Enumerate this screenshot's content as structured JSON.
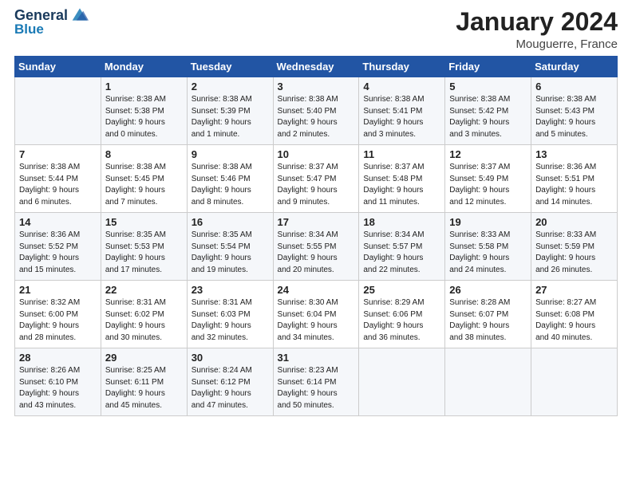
{
  "header": {
    "logo_line1": "General",
    "logo_line2": "Blue",
    "month": "January 2024",
    "location": "Mouguerre, France"
  },
  "weekdays": [
    "Sunday",
    "Monday",
    "Tuesday",
    "Wednesday",
    "Thursday",
    "Friday",
    "Saturday"
  ],
  "weeks": [
    [
      {
        "day": "",
        "info": ""
      },
      {
        "day": "1",
        "info": "Sunrise: 8:38 AM\nSunset: 5:38 PM\nDaylight: 9 hours\nand 0 minutes."
      },
      {
        "day": "2",
        "info": "Sunrise: 8:38 AM\nSunset: 5:39 PM\nDaylight: 9 hours\nand 1 minute."
      },
      {
        "day": "3",
        "info": "Sunrise: 8:38 AM\nSunset: 5:40 PM\nDaylight: 9 hours\nand 2 minutes."
      },
      {
        "day": "4",
        "info": "Sunrise: 8:38 AM\nSunset: 5:41 PM\nDaylight: 9 hours\nand 3 minutes."
      },
      {
        "day": "5",
        "info": "Sunrise: 8:38 AM\nSunset: 5:42 PM\nDaylight: 9 hours\nand 3 minutes."
      },
      {
        "day": "6",
        "info": "Sunrise: 8:38 AM\nSunset: 5:43 PM\nDaylight: 9 hours\nand 5 minutes."
      }
    ],
    [
      {
        "day": "7",
        "info": "Sunrise: 8:38 AM\nSunset: 5:44 PM\nDaylight: 9 hours\nand 6 minutes."
      },
      {
        "day": "8",
        "info": "Sunrise: 8:38 AM\nSunset: 5:45 PM\nDaylight: 9 hours\nand 7 minutes."
      },
      {
        "day": "9",
        "info": "Sunrise: 8:38 AM\nSunset: 5:46 PM\nDaylight: 9 hours\nand 8 minutes."
      },
      {
        "day": "10",
        "info": "Sunrise: 8:37 AM\nSunset: 5:47 PM\nDaylight: 9 hours\nand 9 minutes."
      },
      {
        "day": "11",
        "info": "Sunrise: 8:37 AM\nSunset: 5:48 PM\nDaylight: 9 hours\nand 11 minutes."
      },
      {
        "day": "12",
        "info": "Sunrise: 8:37 AM\nSunset: 5:49 PM\nDaylight: 9 hours\nand 12 minutes."
      },
      {
        "day": "13",
        "info": "Sunrise: 8:36 AM\nSunset: 5:51 PM\nDaylight: 9 hours\nand 14 minutes."
      }
    ],
    [
      {
        "day": "14",
        "info": "Sunrise: 8:36 AM\nSunset: 5:52 PM\nDaylight: 9 hours\nand 15 minutes."
      },
      {
        "day": "15",
        "info": "Sunrise: 8:35 AM\nSunset: 5:53 PM\nDaylight: 9 hours\nand 17 minutes."
      },
      {
        "day": "16",
        "info": "Sunrise: 8:35 AM\nSunset: 5:54 PM\nDaylight: 9 hours\nand 19 minutes."
      },
      {
        "day": "17",
        "info": "Sunrise: 8:34 AM\nSunset: 5:55 PM\nDaylight: 9 hours\nand 20 minutes."
      },
      {
        "day": "18",
        "info": "Sunrise: 8:34 AM\nSunset: 5:57 PM\nDaylight: 9 hours\nand 22 minutes."
      },
      {
        "day": "19",
        "info": "Sunrise: 8:33 AM\nSunset: 5:58 PM\nDaylight: 9 hours\nand 24 minutes."
      },
      {
        "day": "20",
        "info": "Sunrise: 8:33 AM\nSunset: 5:59 PM\nDaylight: 9 hours\nand 26 minutes."
      }
    ],
    [
      {
        "day": "21",
        "info": "Sunrise: 8:32 AM\nSunset: 6:00 PM\nDaylight: 9 hours\nand 28 minutes."
      },
      {
        "day": "22",
        "info": "Sunrise: 8:31 AM\nSunset: 6:02 PM\nDaylight: 9 hours\nand 30 minutes."
      },
      {
        "day": "23",
        "info": "Sunrise: 8:31 AM\nSunset: 6:03 PM\nDaylight: 9 hours\nand 32 minutes."
      },
      {
        "day": "24",
        "info": "Sunrise: 8:30 AM\nSunset: 6:04 PM\nDaylight: 9 hours\nand 34 minutes."
      },
      {
        "day": "25",
        "info": "Sunrise: 8:29 AM\nSunset: 6:06 PM\nDaylight: 9 hours\nand 36 minutes."
      },
      {
        "day": "26",
        "info": "Sunrise: 8:28 AM\nSunset: 6:07 PM\nDaylight: 9 hours\nand 38 minutes."
      },
      {
        "day": "27",
        "info": "Sunrise: 8:27 AM\nSunset: 6:08 PM\nDaylight: 9 hours\nand 40 minutes."
      }
    ],
    [
      {
        "day": "28",
        "info": "Sunrise: 8:26 AM\nSunset: 6:10 PM\nDaylight: 9 hours\nand 43 minutes."
      },
      {
        "day": "29",
        "info": "Sunrise: 8:25 AM\nSunset: 6:11 PM\nDaylight: 9 hours\nand 45 minutes."
      },
      {
        "day": "30",
        "info": "Sunrise: 8:24 AM\nSunset: 6:12 PM\nDaylight: 9 hours\nand 47 minutes."
      },
      {
        "day": "31",
        "info": "Sunrise: 8:23 AM\nSunset: 6:14 PM\nDaylight: 9 hours\nand 50 minutes."
      },
      {
        "day": "",
        "info": ""
      },
      {
        "day": "",
        "info": ""
      },
      {
        "day": "",
        "info": ""
      }
    ]
  ]
}
